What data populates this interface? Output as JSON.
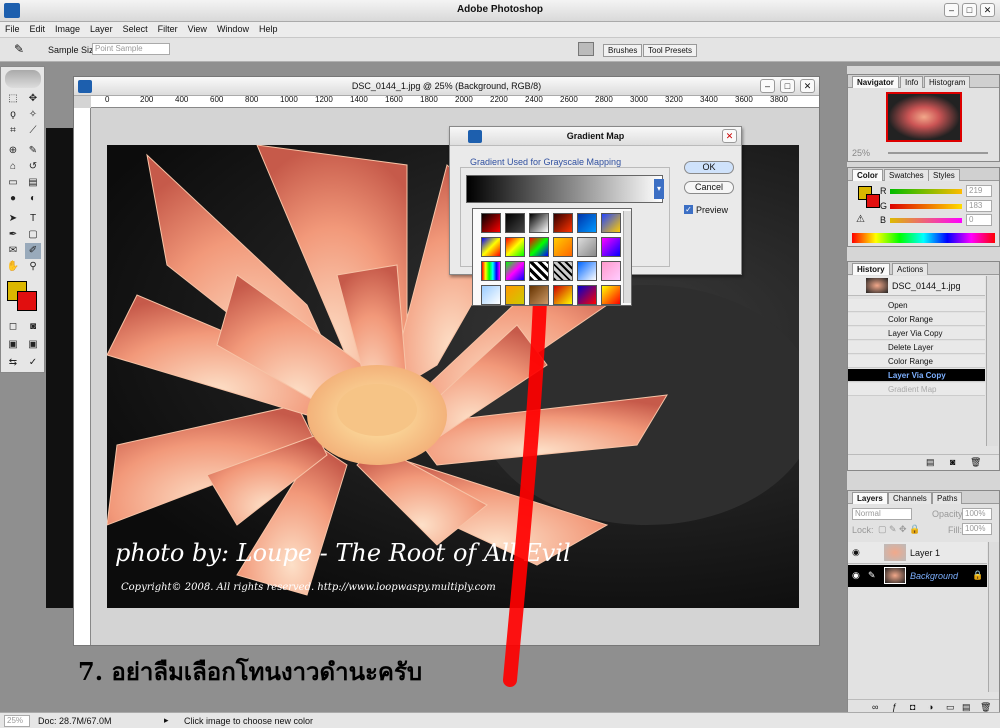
{
  "app": {
    "title": "Adobe Photoshop"
  },
  "menu": [
    "File",
    "Edit",
    "Image",
    "Layer",
    "Select",
    "Filter",
    "View",
    "Window",
    "Help"
  ],
  "options": {
    "sample_size_label": "Sample Size:",
    "sample_size_value": "Point Sample",
    "brushes_tab": "Brushes",
    "tool_presets_tab": "Tool Presets"
  },
  "document": {
    "title": "DSC_0144_1.jpg @ 25% (Background, RGB/8)",
    "ruler_ticks": [
      "0",
      "200",
      "400",
      "600",
      "800",
      "1000",
      "1200",
      "1400",
      "1600",
      "1800",
      "2000",
      "2200",
      "2400",
      "2600",
      "2800",
      "3000",
      "3200",
      "3400",
      "3600",
      "3800"
    ],
    "credit_line1": "photo by: Loupe - The Root of All Evil",
    "credit_line2": "Copyright© 2008. All rights reserved. http://www.loopwaspy.multiply.com"
  },
  "instruction": "7. อย่าลืมเลือกโทนงาวดำนะครับ",
  "dialog": {
    "title": "Gradient Map",
    "group_label": "Gradient Used for Grayscale Mapping",
    "ok": "OK",
    "cancel": "Cancel",
    "preview": "Preview",
    "preview_checked": true
  },
  "navigator": {
    "tabs": [
      "Navigator",
      "Info",
      "Histogram"
    ],
    "zoom": "25%"
  },
  "color_panel": {
    "tabs": [
      "Color",
      "Swatches",
      "Styles"
    ],
    "channels": [
      {
        "label": "R",
        "value": "219"
      },
      {
        "label": "G",
        "value": "183"
      },
      {
        "label": "B",
        "value": "0"
      }
    ]
  },
  "history": {
    "tabs": [
      "History",
      "Actions"
    ],
    "snapshot": "DSC_0144_1.jpg",
    "items": [
      "Open",
      "Color Range",
      "Layer Via Copy",
      "Delete Layer",
      "Color Range",
      "Layer Via Copy",
      "Gradient Map"
    ],
    "active_index": 5
  },
  "layers": {
    "tabs": [
      "Layers",
      "Channels",
      "Paths"
    ],
    "blend_mode": "Normal",
    "opacity_label": "Opacity:",
    "opacity": "100%",
    "lock_label": "Lock:",
    "fill_label": "Fill:",
    "fill": "100%",
    "items": [
      "Layer 1",
      "Background"
    ]
  },
  "status": {
    "zoom": "25%",
    "doc": "Doc: 28.7M/67.0M",
    "hint": "Click image to choose new color"
  },
  "colors": {
    "foreground": "#dbb700",
    "background": "#e10f0f",
    "annotation": "#ff0000"
  }
}
